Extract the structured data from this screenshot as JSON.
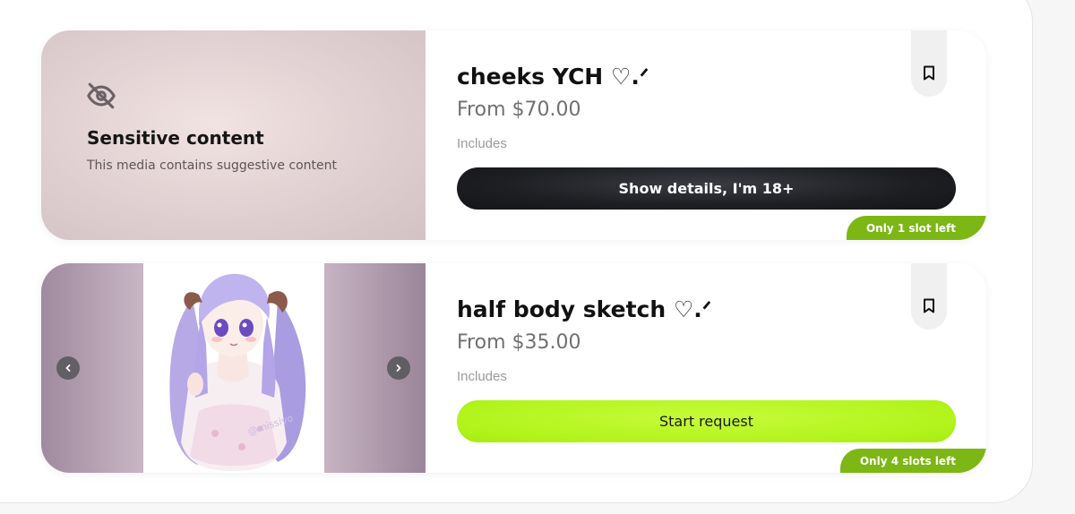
{
  "listings": [
    {
      "title": "cheeks YCH ♡.ᐟ",
      "price": "From $70.00",
      "includes_label": "Includes",
      "action_label": "Show details, I'm 18+",
      "slots": "Only 1 slot left",
      "sensitive": {
        "title": "Sensitive content",
        "subtitle": "This media contains suggestive content",
        "icon": "eye-off-icon"
      }
    },
    {
      "title": "half body sketch ♡.ᐟ",
      "price": "From $35.00",
      "includes_label": "Includes",
      "action_label": "Start request",
      "slots": "Only 4 slots left",
      "image_watermark": "@missivo"
    }
  ],
  "colors": {
    "lime_button": "#b2f41c",
    "dark_button": "#1d1e22",
    "slot_badge": "#7cb715"
  }
}
